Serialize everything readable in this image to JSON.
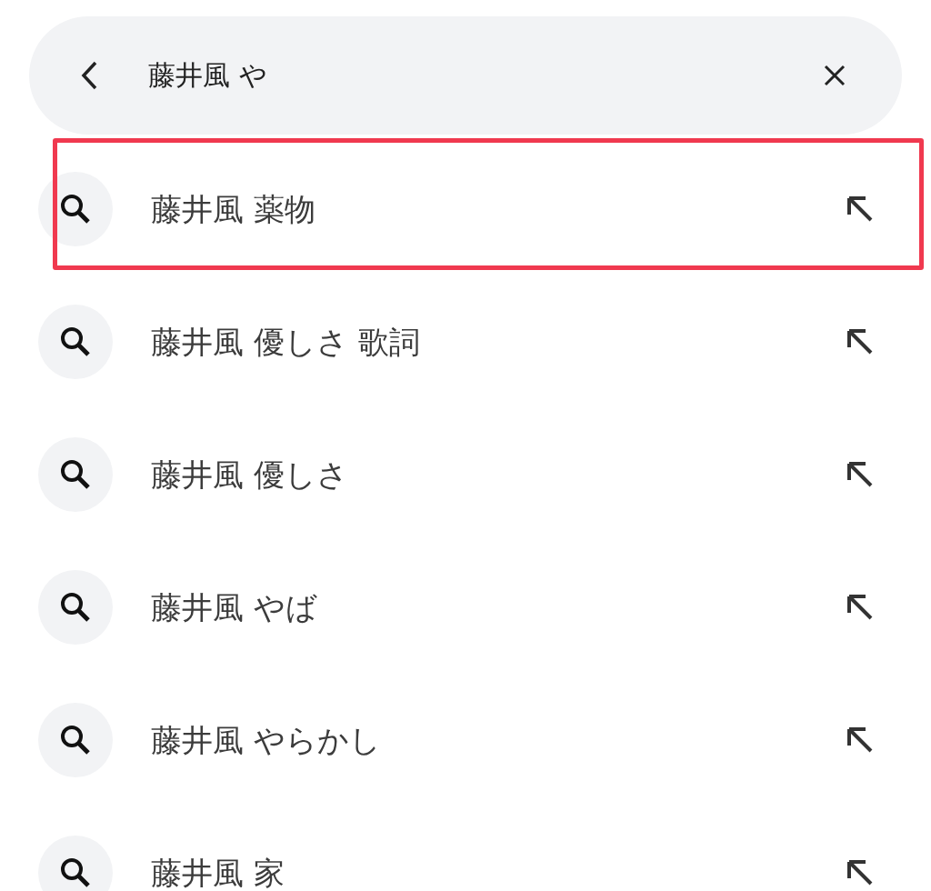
{
  "search": {
    "value": "藤井風 や"
  },
  "suggestions": [
    {
      "text": "藤井風 薬物",
      "highlighted": true
    },
    {
      "text": "藤井風 優しさ 歌詞",
      "highlighted": false
    },
    {
      "text": "藤井風 優しさ",
      "highlighted": false
    },
    {
      "text": "藤井風 やば",
      "highlighted": false
    },
    {
      "text": "藤井風 やらかし",
      "highlighted": false
    },
    {
      "text": "藤井風 家",
      "highlighted": false
    }
  ]
}
